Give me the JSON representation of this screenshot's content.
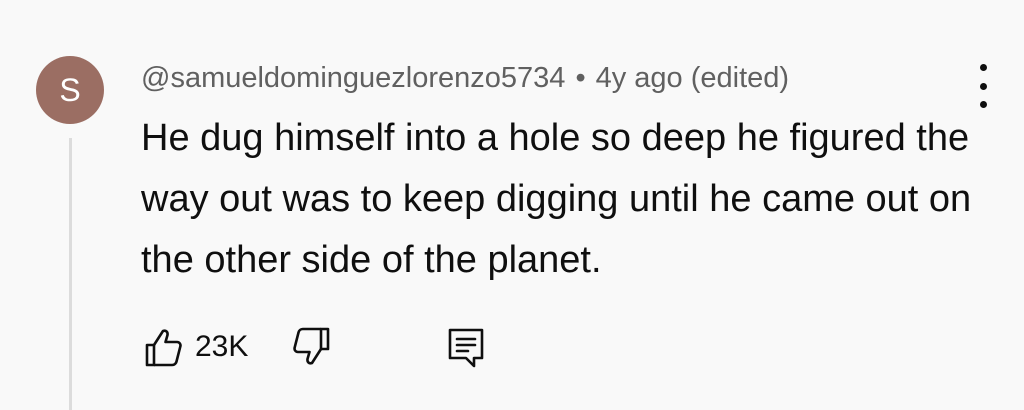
{
  "comment": {
    "avatar_letter": "S",
    "avatar_color": "#9b6e63",
    "author": "@samueldominguezlorenzo5734",
    "separator": "•",
    "timestamp": "4y ago (edited)",
    "text": "He dug himself into a hole so deep he figured the way out was to keep digging until he came out on the other side of the planet.",
    "like_count": "23K",
    "icons": {
      "like": "thumbs-up-icon",
      "dislike": "thumbs-down-icon",
      "reply": "reply-comment-icon",
      "menu": "more-vertical-icon"
    }
  }
}
